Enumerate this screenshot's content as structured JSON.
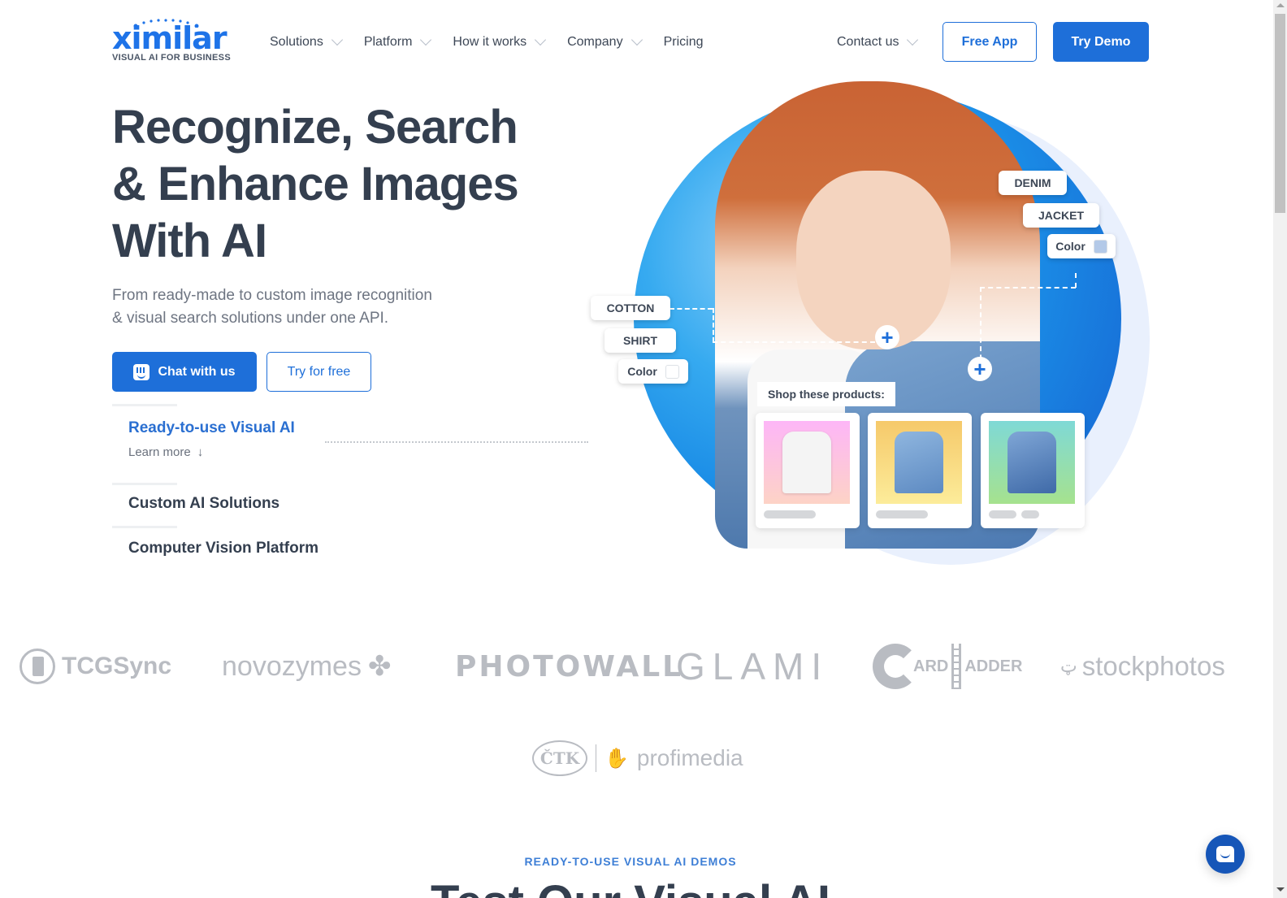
{
  "brand": {
    "name": "ximilar",
    "tagline": "VISUAL AI FOR BUSINESS",
    "accent_color": "#1e6fd9"
  },
  "nav": {
    "items": [
      {
        "label": "Solutions",
        "has_dropdown": true
      },
      {
        "label": "Platform",
        "has_dropdown": true
      },
      {
        "label": "How it works",
        "has_dropdown": true
      },
      {
        "label": "Company",
        "has_dropdown": true
      },
      {
        "label": "Pricing",
        "has_dropdown": false
      }
    ],
    "contact": {
      "label": "Contact us",
      "has_dropdown": true
    },
    "free_app_label": "Free App",
    "try_demo_label": "Try Demo"
  },
  "hero": {
    "title_lines": [
      "Recognize, Search",
      "& Enhance Images",
      "With AI"
    ],
    "subtitle_lines": [
      "From ready-made to custom image recognition",
      "& visual search solutions under one API."
    ],
    "chat_button_label": "Chat with us",
    "try_free_label": "Try for free",
    "tabs": [
      {
        "label": "Ready-to-use Visual AI",
        "active": true,
        "learn_more": "Learn more"
      },
      {
        "label": "Custom AI Solutions",
        "active": false
      },
      {
        "label": "Computer Vision Platform",
        "active": false
      }
    ]
  },
  "illustration": {
    "tags_right": [
      "DENIM",
      "JACKET",
      "Color"
    ],
    "tags_left": [
      "COTTON",
      "SHIRT",
      "Color"
    ],
    "right_color_swatch": "#b3c9e8",
    "left_color_swatch": "#ffffff",
    "shop_label": "Shop these products:",
    "products": [
      {
        "name": "white shirt",
        "bg_from": "#fdb6f7",
        "bg_to": "#fdd3c6",
        "bars": 1
      },
      {
        "name": "light denim jacket",
        "bg_from": "#f6c96a",
        "bg_to": "#fcec9a",
        "bars": 1
      },
      {
        "name": "denim jacket",
        "bg_from": "#7fd9d6",
        "bg_to": "#a6e28e",
        "bars": 2
      }
    ]
  },
  "clients": {
    "logos": [
      "TCGSync",
      "novozymes",
      "PHOTOWALL",
      "GLAMI",
      "CARD LADDER",
      "stockphotos",
      "ČTK | profimedia"
    ],
    "tcg": "TCGSync",
    "novo": "novozymes",
    "photowall": "PHOTOWALL",
    "glami": "GLAMI",
    "card_ladder_a": "ARD",
    "card_ladder_b": "ADDER",
    "stock": "stockphotos",
    "ctk": "ČTK",
    "profimedia": "profimedia"
  },
  "demos": {
    "eyebrow": "READY-TO-USE VISUAL AI DEMOS",
    "title": "Test Our Visual AI"
  }
}
